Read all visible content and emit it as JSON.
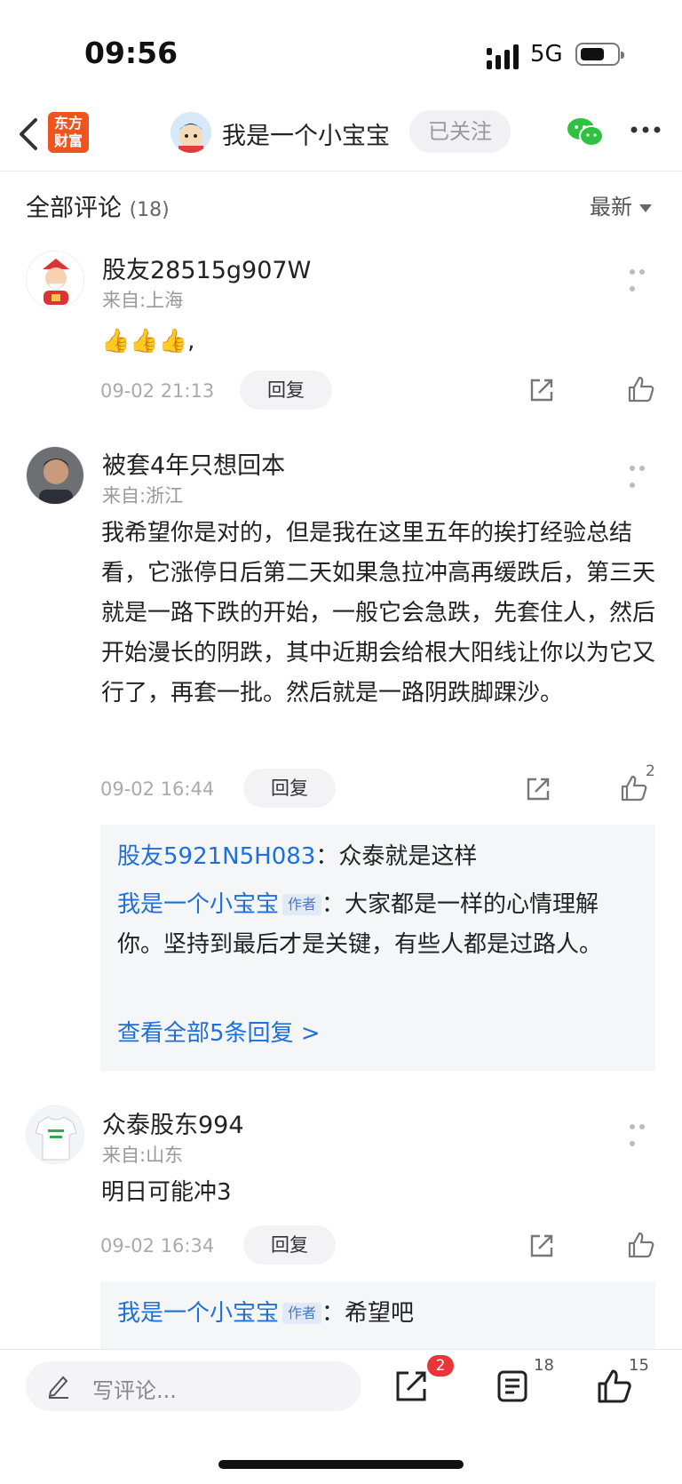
{
  "status_bar": {
    "time": "09:56",
    "network": "5G"
  },
  "nav": {
    "logo_line1": "东方",
    "logo_line2": "财富",
    "title": "我是一个小宝宝",
    "follow_label": "已关注"
  },
  "comments_header": {
    "title": "全部评论",
    "count": "(18)",
    "sort_label": "最新"
  },
  "comments": [
    {
      "username": "股友28515g907W",
      "location": "来自:上海",
      "text": "👍👍👍,",
      "time": "09-02 21:13",
      "reply_label": "回复",
      "like_count": ""
    },
    {
      "username": "被套4年只想回本",
      "location": "来自:浙江",
      "text": "我希望你是对的，但是我在这里五年的挨打经验总结看，它涨停日后第二天如果急拉冲高再缓跌后，第三天就是一路下跌的开始，一般它会急跌，先套住人，然后开始漫长的阴跌，其中近期会给根大阳线让你以为它又行了，再套一批。然后就是一路阴跌脚踝沙。",
      "time": "09-02 16:44",
      "reply_label": "回复",
      "like_count": "2",
      "replies": [
        {
          "user": "股友5921N5H083",
          "tag": "",
          "text": "众泰就是这样"
        },
        {
          "user": "我是一个小宝宝",
          "tag": "作者",
          "text": "大家都是一样的心情理解你。坚持到最后才是关键，有些人都是过路人。"
        }
      ],
      "view_all": "查看全部5条回复 >"
    },
    {
      "username": "众泰股东994",
      "location": "来自:山东",
      "text": "明日可能冲3",
      "time": "09-02 16:34",
      "reply_label": "回复",
      "like_count": "",
      "replies": [
        {
          "user": "我是一个小宝宝",
          "tag": "作者",
          "text": "希望吧"
        }
      ]
    }
  ],
  "bottom_bar": {
    "write_placeholder": "写评论...",
    "share_badge": "2",
    "comment_count": "18",
    "like_count": "15"
  },
  "colors": {
    "accent_blue": "#1e6fd9",
    "brand_orange": "#f0541e",
    "badge_red": "#e9343a"
  }
}
